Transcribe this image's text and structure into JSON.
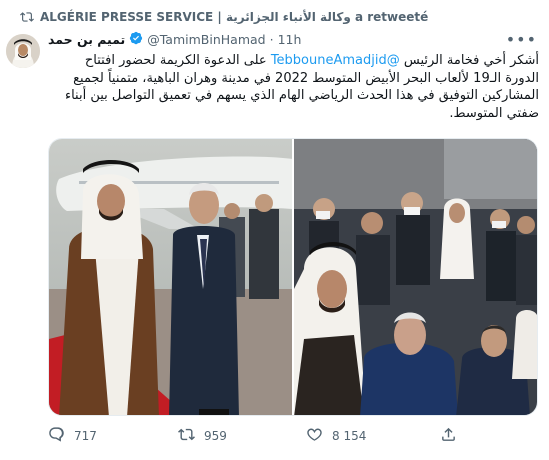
{
  "retweet": {
    "icon": "retweet-icon",
    "text": "ALGÉRIE PRESSE SERVICE | وكالة الأنباء الجزائرية a retweeté"
  },
  "tweet": {
    "display_name": "تميم بن حمد",
    "handle": "@TamimBinHamad",
    "separator": "·",
    "time": "11h",
    "more_icon": "more-icon",
    "text_before_mention": "أشكر أخي فخامة الرئيس",
    "mention": "@TebbouneAmadjid",
    "text_after_mention": "على الدعوة الكريمة لحضور افتتاح الدورة الـ19 لألعاب البحر الأبيض المتوسط 2022 في مدينة وهران الباهية، متمنياً لجميع المشاركين التوفيق في هذا الحدث الرياضي الهام الذي يسهم في تعميق التواصل بين أبناء ضفتي المتوسط."
  },
  "actions": {
    "reply": {
      "icon": "reply-icon",
      "count": "717"
    },
    "retweet": {
      "icon": "retweet-icon",
      "count": "959"
    },
    "like": {
      "icon": "heart-icon",
      "count": "8 154"
    },
    "share": {
      "icon": "share-icon"
    }
  },
  "colors": {
    "accent": "#1d9bf0",
    "muted": "#536471",
    "text": "#0f1419",
    "verified": "#1d9bf0"
  }
}
